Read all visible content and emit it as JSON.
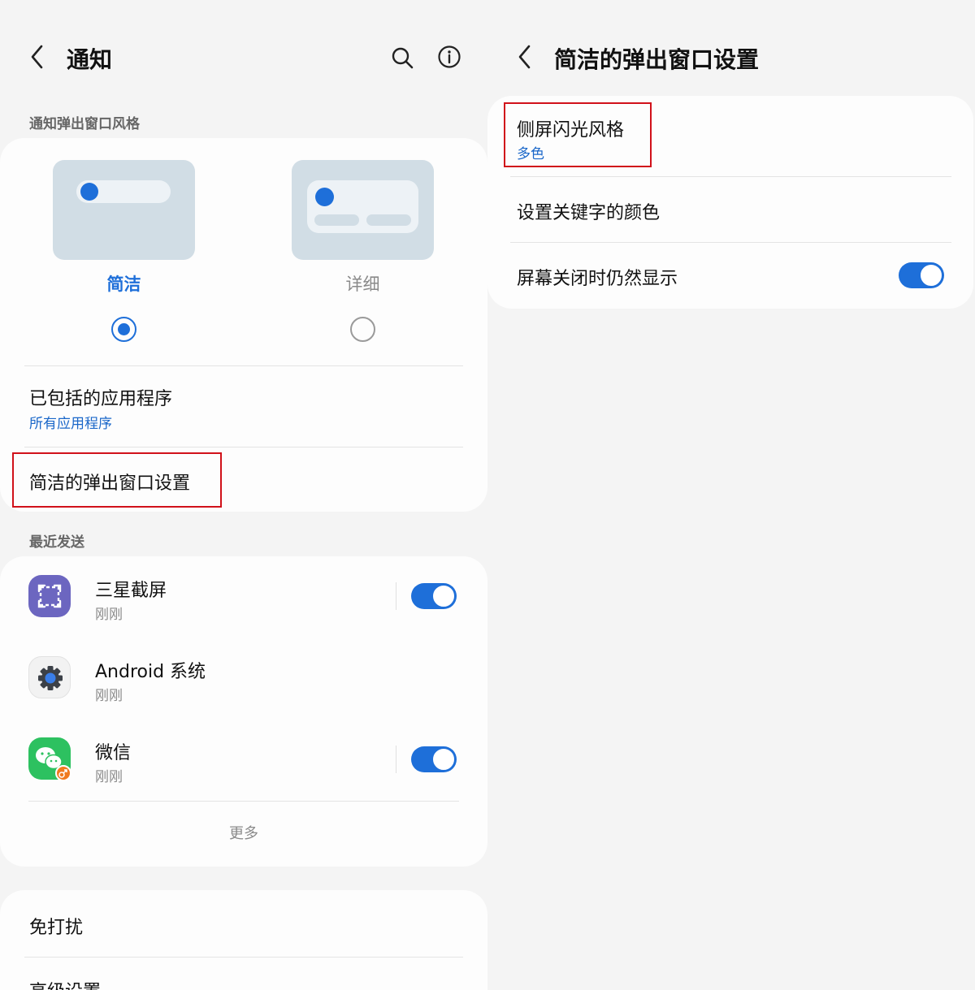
{
  "left": {
    "header": {
      "title": "通知"
    },
    "section_style_label": "通知弹出窗口风格",
    "styles": [
      {
        "label": "简洁",
        "selected": true
      },
      {
        "label": "详细",
        "selected": false
      }
    ],
    "included_apps": {
      "title": "已包括的应用程序",
      "subtitle": "所有应用程序"
    },
    "brief_popup_settings": {
      "title": "简洁的弹出窗口设置"
    },
    "recent_label": "最近发送",
    "recent_apps": [
      {
        "name": "三星截屏",
        "time": "刚刚",
        "toggle": true
      },
      {
        "name": "Android 系统",
        "time": "刚刚",
        "toggle": null
      },
      {
        "name": "微信",
        "time": "刚刚",
        "toggle": true
      }
    ],
    "more_label": "更多",
    "dnd": {
      "title": "免打扰"
    },
    "advanced": {
      "title": "高级设置"
    }
  },
  "right": {
    "header": {
      "title": "简洁的弹出窗口设置"
    },
    "edge_flash": {
      "title": "侧屏闪光风格",
      "subtitle": "多色"
    },
    "keyword_color": {
      "title": "设置关键字的颜色"
    },
    "show_when_off": {
      "title": "屏幕关闭时仍然显示",
      "toggle": true
    }
  },
  "colors": {
    "accent": "#1e6fd9",
    "highlight": "#d1111a",
    "wechat": "#2dc160",
    "samsung_capture": "#6c66c0"
  }
}
